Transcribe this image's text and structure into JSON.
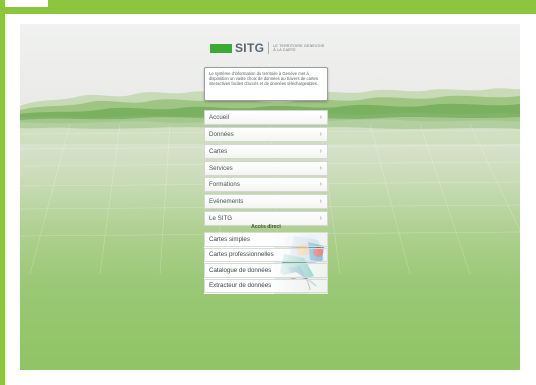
{
  "header": {
    "logo_text": "SITG",
    "tagline_line1": "LE TERRITOIRE GENEVOIS",
    "tagline_line2": "À LA CARTE"
  },
  "intro": {
    "text": "Le système d'information du territoire à Genève met à disposition un vaste choix de données au travers de cartes interactives faciles d'accès et de données téléchargeables."
  },
  "menu": {
    "items": [
      {
        "label": "Accueil"
      },
      {
        "label": "Données"
      },
      {
        "label": "Cartes"
      },
      {
        "label": "Services"
      },
      {
        "label": "Formations"
      },
      {
        "label": "Evénements"
      },
      {
        "label": "Le SITG"
      }
    ],
    "chevron": "›"
  },
  "direct_access": {
    "title": "Accès direct",
    "items": [
      {
        "label": "Cartes simples"
      },
      {
        "label": "Cartes professionnelles"
      },
      {
        "label": "Catalogue de données"
      },
      {
        "label": "Extracteur de données"
      }
    ]
  },
  "colors": {
    "frame_green": "#8cc63f",
    "logo_green": "#3aaa35",
    "text_grey": "#5b6770"
  }
}
